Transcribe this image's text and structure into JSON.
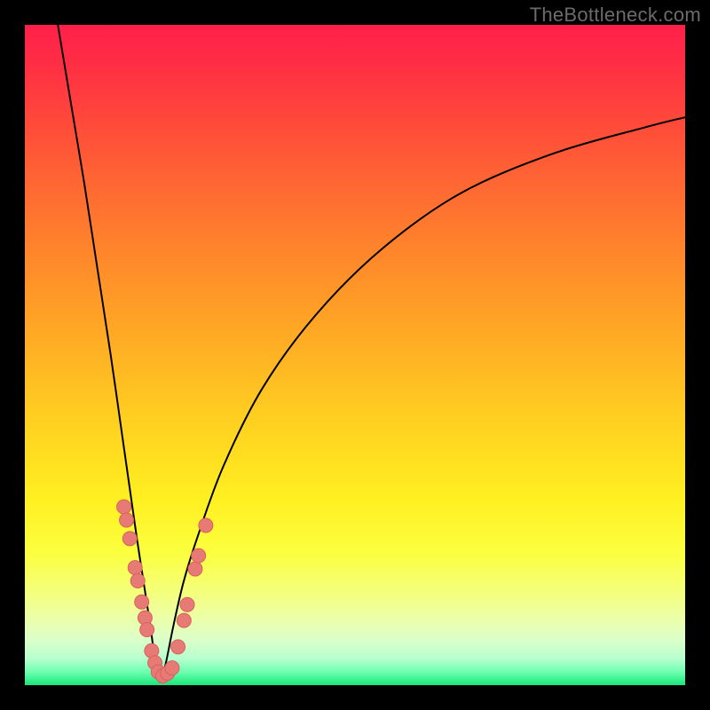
{
  "watermark": {
    "text": "TheBottleneck.com"
  },
  "palette": {
    "frame": "#000000",
    "curve_stroke": "#000000",
    "marker_fill": "#e77a75",
    "marker_stroke": "#d8615c"
  },
  "chart_data": {
    "type": "line",
    "title": "",
    "xlabel": "",
    "ylabel": "",
    "xlim": [
      0,
      100
    ],
    "ylim": [
      0,
      100
    ],
    "grid": false,
    "legend": false,
    "notes": "Two thin black curves descending from the top edges into a sharp V near x≈20 at the bottom (y≈0), then the right branch rises toward the upper right. No numeric axis labels are rendered; values below are visual estimates in percent of plot width/height.",
    "series": [
      {
        "name": "left-branch",
        "x": [
          5,
          7,
          9,
          11,
          13,
          15,
          16,
          17,
          18,
          19,
          19.6,
          20,
          20.4
        ],
        "y": [
          100,
          88,
          76,
          63,
          50,
          36,
          29,
          22,
          15.5,
          9,
          4.5,
          1.8,
          0.5
        ]
      },
      {
        "name": "right-branch",
        "x": [
          20.6,
          21,
          21.6,
          22.5,
          24,
          26,
          30,
          36,
          44,
          54,
          66,
          80,
          94,
          100
        ],
        "y": [
          0.5,
          1.8,
          4.5,
          9,
          15.5,
          22,
          33,
          45,
          56,
          66,
          74.5,
          80.5,
          84.5,
          86
        ]
      }
    ],
    "markers": {
      "name": "bead-cluster",
      "shape": "circle",
      "radius_px": 8,
      "points_xy": [
        [
          15.0,
          27.0
        ],
        [
          15.4,
          25.0
        ],
        [
          15.9,
          22.2
        ],
        [
          16.7,
          17.8
        ],
        [
          17.1,
          15.8
        ],
        [
          17.7,
          12.6
        ],
        [
          18.2,
          10.2
        ],
        [
          18.5,
          8.4
        ],
        [
          19.2,
          5.2
        ],
        [
          19.7,
          3.4
        ],
        [
          20.2,
          2.0
        ],
        [
          20.9,
          1.4
        ],
        [
          21.6,
          1.8
        ],
        [
          22.3,
          2.6
        ],
        [
          23.2,
          5.8
        ],
        [
          24.1,
          9.8
        ],
        [
          24.6,
          12.2
        ],
        [
          25.8,
          17.6
        ],
        [
          26.3,
          19.6
        ],
        [
          27.4,
          24.2
        ]
      ]
    }
  }
}
